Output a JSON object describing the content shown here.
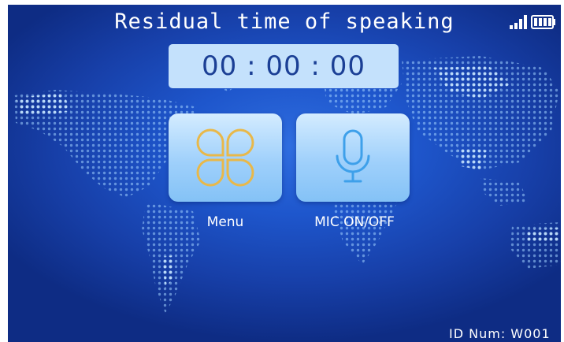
{
  "header": {
    "title": "Residual time of speaking"
  },
  "timer": {
    "value": "00 : 00 : 00"
  },
  "actions": {
    "menu_label": "Menu",
    "mic_label": "MIC ON/OFF"
  },
  "footer": {
    "id_label": "ID Num: W001"
  },
  "icons": {
    "menu": "clover-icon",
    "mic": "microphone-icon",
    "signal": "signal-icon",
    "battery": "battery-icon"
  },
  "colors": {
    "background": "#1e56cc",
    "timer_box": "#c4e1fc",
    "timer_text": "#1b3f95",
    "menu_icon": "#e8b84a",
    "mic_icon": "#3ea0ea"
  }
}
